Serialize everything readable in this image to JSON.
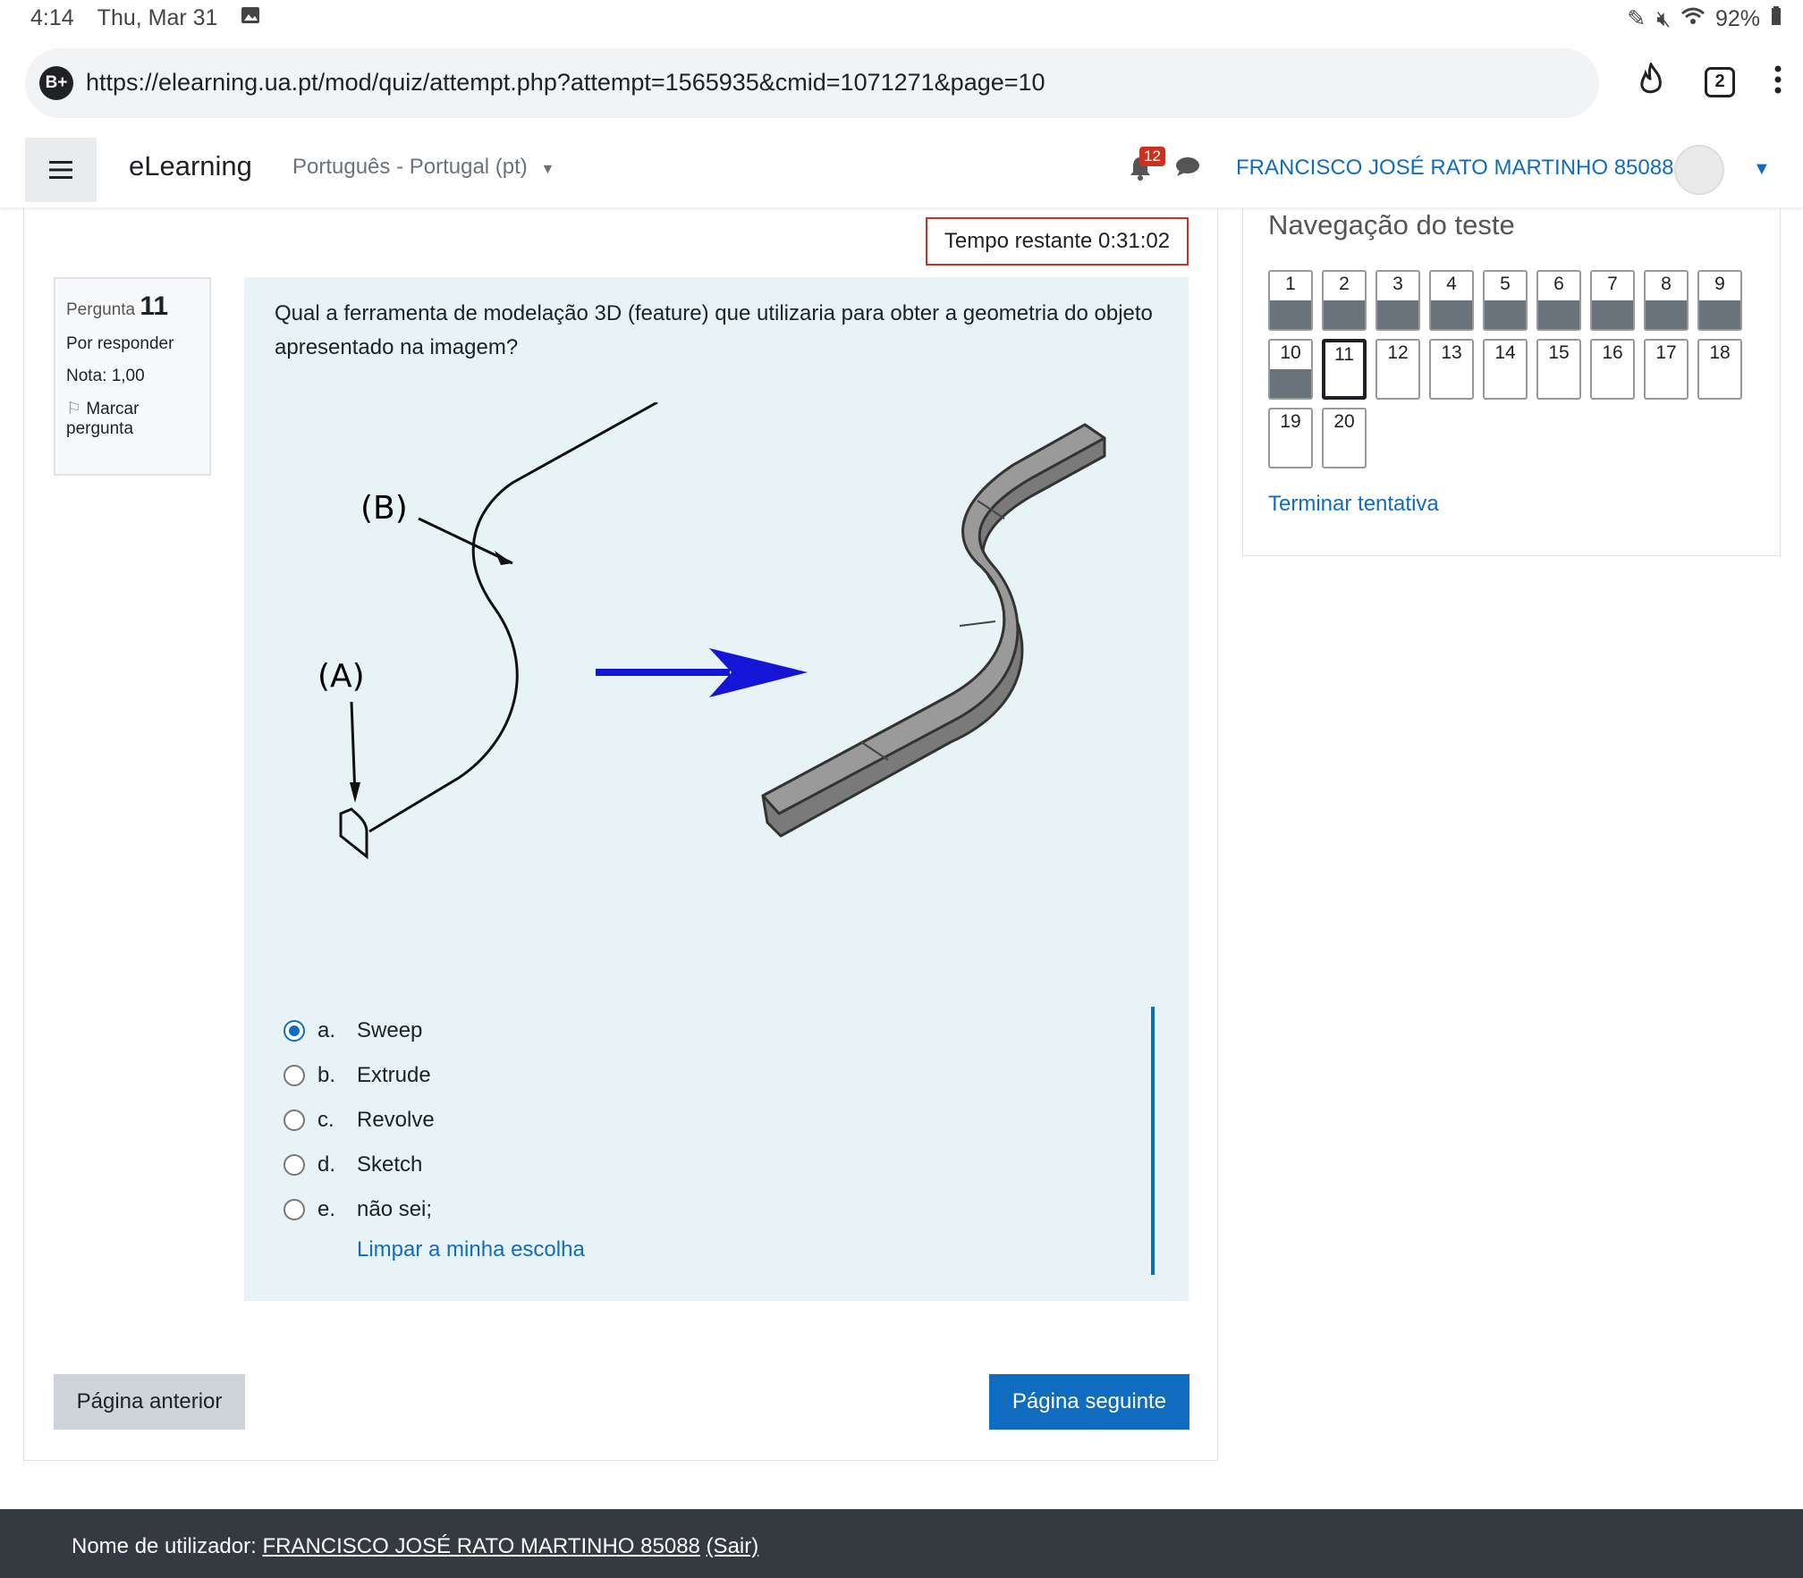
{
  "status_bar": {
    "time": "4:14",
    "date": "Thu, Mar 31",
    "battery": "92%"
  },
  "browser": {
    "badge": "B+",
    "url": "https://elearning.ua.pt/mod/quiz/attempt.php?attempt=1565935&cmid=1071271&page=10",
    "tab_count": "2"
  },
  "navbar": {
    "brand": "eLearning",
    "language": "Português - Portugal (pt)",
    "notifications": "12",
    "user": "FRANCISCO JOSÉ RATO MARTINHO 85088"
  },
  "timer": "Tempo restante 0:31:02",
  "question_info": {
    "label": "Pergunta",
    "number": "11",
    "state": "Por responder",
    "grade": "Nota: 1,00",
    "flag": "Marcar pergunta"
  },
  "question": {
    "text": "Qual a ferramenta de modelação 3D (feature) que utilizaria para obter a geometria do objeto apresentado na imagem?",
    "figure_labels": {
      "a": "(A)",
      "b": "(B)"
    },
    "answers": [
      {
        "letter": "a.",
        "text": "Sweep",
        "checked": true
      },
      {
        "letter": "b.",
        "text": "Extrude",
        "checked": false
      },
      {
        "letter": "c.",
        "text": "Revolve",
        "checked": false
      },
      {
        "letter": "d.",
        "text": "Sketch",
        "checked": false
      },
      {
        "letter": "e.",
        "text": "não sei;",
        "checked": false
      }
    ],
    "clear": "Limpar a minha escolha"
  },
  "buttons": {
    "prev": "Página anterior",
    "next": "Página seguinte"
  },
  "quiz_nav": {
    "title": "Navegação do teste",
    "questions": [
      {
        "n": "1",
        "state": "answered"
      },
      {
        "n": "2",
        "state": "answered"
      },
      {
        "n": "3",
        "state": "answered"
      },
      {
        "n": "4",
        "state": "answered"
      },
      {
        "n": "5",
        "state": "answered"
      },
      {
        "n": "6",
        "state": "answered"
      },
      {
        "n": "7",
        "state": "answered"
      },
      {
        "n": "8",
        "state": "answered"
      },
      {
        "n": "9",
        "state": "answered"
      },
      {
        "n": "10",
        "state": "answered"
      },
      {
        "n": "11",
        "state": "current"
      },
      {
        "n": "12",
        "state": "open"
      },
      {
        "n": "13",
        "state": "open"
      },
      {
        "n": "14",
        "state": "open"
      },
      {
        "n": "15",
        "state": "open"
      },
      {
        "n": "16",
        "state": "open"
      },
      {
        "n": "17",
        "state": "open"
      },
      {
        "n": "18",
        "state": "open"
      },
      {
        "n": "19",
        "state": "open"
      },
      {
        "n": "20",
        "state": "open"
      }
    ],
    "finish": "Terminar tentativa"
  },
  "footer": {
    "label": "Nome de utilizador:",
    "user": "FRANCISCO JOSÉ RATO MARTINHO 85088",
    "logout": "(Sair)"
  }
}
